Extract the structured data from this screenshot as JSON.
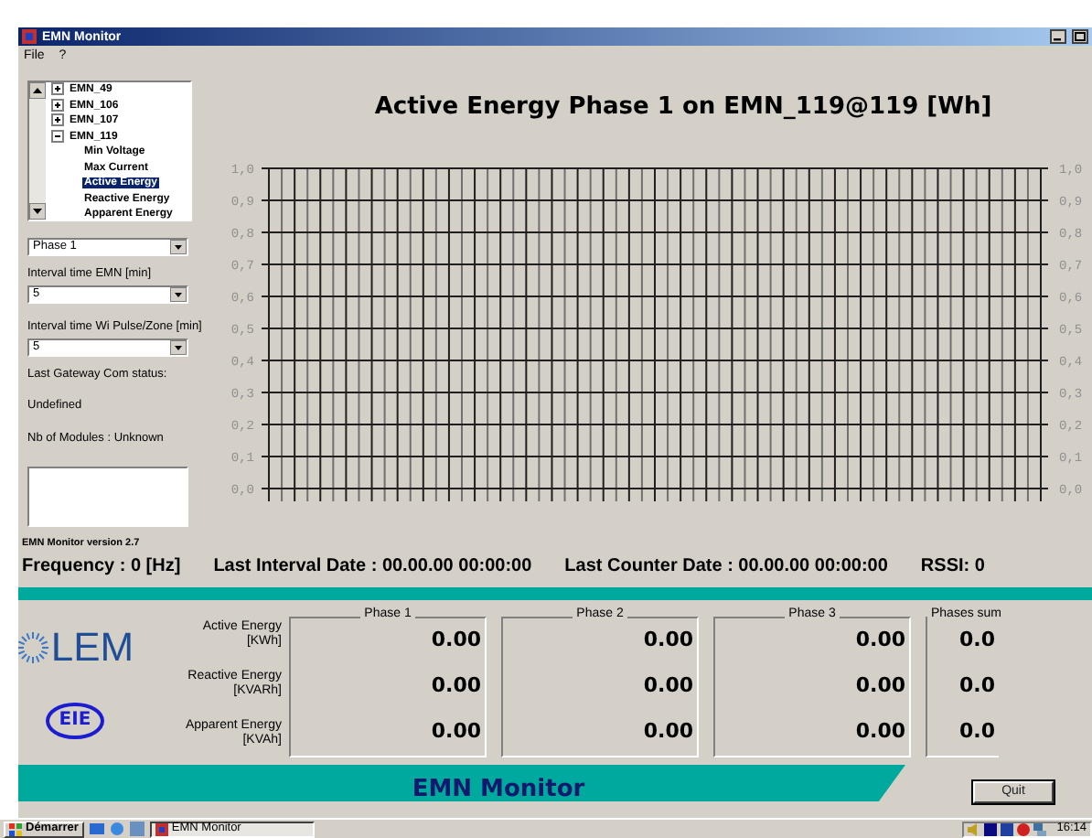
{
  "window": {
    "title": "EMN Monitor"
  },
  "menu": [
    {
      "label": "File"
    },
    {
      "label": "?"
    }
  ],
  "tree": [
    {
      "label": "EMN_49",
      "expanded": false,
      "selected": false
    },
    {
      "label": "EMN_106",
      "expanded": false,
      "selected": false
    },
    {
      "label": "EMN_107",
      "expanded": false,
      "selected": false
    },
    {
      "label": "EMN_119",
      "expanded": true,
      "selected": false,
      "children": [
        {
          "label": "Min Voltage",
          "selected": false
        },
        {
          "label": "Max Current",
          "selected": false
        },
        {
          "label": "Active Energy",
          "selected": true
        },
        {
          "label": "Reactive Energy",
          "selected": false
        },
        {
          "label": "Apparent Energy",
          "selected": false
        }
      ]
    }
  ],
  "phase_select": {
    "value": "Phase 1"
  },
  "interval_emn": {
    "label": "Interval time EMN [min]",
    "value": "5"
  },
  "interval_wi": {
    "label": "Interval time Wi Pulse/Zone [min]",
    "value": "5"
  },
  "gateway_status": {
    "label": "Last Gateway Com status:",
    "value": "Undefined"
  },
  "modules": "Nb of Modules : Unknown",
  "chart": {
    "title": "Active Energy Phase 1 on EMN_119@119 [Wh]",
    "left_axis_labels": [
      "1,0",
      "0,9",
      "0,8",
      "0,7",
      "0,6",
      "0,5",
      "0,4",
      "0,3",
      "0,2",
      "0,1",
      "0,0"
    ],
    "right_axis_labels": [
      "1,0",
      "0,9",
      "0,8",
      "0,7",
      "0,6",
      "0,5",
      "0,4",
      "0,3",
      "0,2",
      "0,1",
      "0,0"
    ]
  },
  "version": "EMN Monitor version 2.7",
  "status": [
    "Frequency : 0 [Hz]",
    "Last Interval Date : 00.00.00 00:00:00",
    "Last Counter Date : 00.00.00 00:00:00",
    "RSSI: 0"
  ],
  "logos": [
    "LEM",
    "EIE"
  ],
  "energy": {
    "rows": [
      {
        "label": "Active Energy",
        "unit": "[KWh]"
      },
      {
        "label": "Reactive Energy",
        "unit": "[KVARh]"
      },
      {
        "label": "Apparent Energy",
        "unit": "[KVAh]"
      }
    ],
    "groups": [
      {
        "title": "Phase 1",
        "values": [
          "0.00",
          "0.00",
          "0.00"
        ]
      },
      {
        "title": "Phase 2",
        "values": [
          "0.00",
          "0.00",
          "0.00"
        ]
      },
      {
        "title": "Phase 3",
        "values": [
          "0.00",
          "0.00",
          "0.00"
        ]
      },
      {
        "title": "Phases sum",
        "values": [
          "0.0",
          "0.0",
          "0.0"
        ]
      }
    ]
  },
  "footer": {
    "title": "EMN Monitor",
    "button": "Quit"
  },
  "taskbar": {
    "start": "Démarrer",
    "tasks": [
      "EMN Monitor"
    ],
    "clock": "16:14"
  }
}
